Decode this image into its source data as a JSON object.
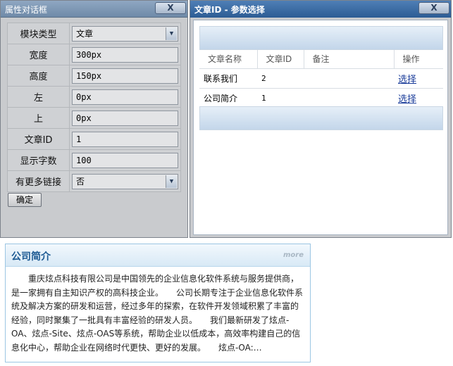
{
  "left_dialog": {
    "title": "属性对话框",
    "close_label": "X",
    "fields": [
      {
        "label": "模块类型",
        "value": "文章",
        "type": "select"
      },
      {
        "label": "宽度",
        "value": "300px",
        "type": "text"
      },
      {
        "label": "高度",
        "value": "150px",
        "type": "text"
      },
      {
        "label": "左",
        "value": "0px",
        "type": "text"
      },
      {
        "label": "上",
        "value": "0px",
        "type": "text"
      },
      {
        "label": "文章ID",
        "value": "1",
        "type": "text"
      },
      {
        "label": "显示字数",
        "value": "100",
        "type": "text"
      },
      {
        "label": "有更多链接",
        "value": "否",
        "type": "select"
      }
    ],
    "ok_label": "确定"
  },
  "right_dialog": {
    "title": "文章ID - 参数选择",
    "close_label": "X",
    "columns": [
      "文章名称",
      "文章ID",
      "备注",
      "操作"
    ],
    "rows": [
      {
        "name": "联系我们",
        "id": "2",
        "note": "",
        "action": "选择"
      },
      {
        "name": "公司简介",
        "id": "1",
        "note": "",
        "action": "选择"
      }
    ]
  },
  "panel": {
    "title": "公司简介",
    "more_label": "more",
    "body": "重庆炫点科技有限公司是中国领先的企业信息化软件系统与服务提供商，是一家拥有自主知识产权的高科技企业。　　公司长期专注于企业信息化软件系统及解决方案的研发和运营，经过多年的探索，在软件开发领域积累了丰富的经验，同时聚集了一批具有丰富经验的研发人员。　　我们最新研发了炫点-OA、炫点-Site、炫点-OAS等系统，帮助企业以低成本，高效率构建自己的信息化中心，帮助企业在网络时代更快、更好的发展。　　炫点-OA:…"
  },
  "colors": {
    "left_titlebar": "#7f98b5",
    "right_titlebar": "#3a6aa3",
    "panel_title": "#1d5a93",
    "link": "#1a3c9a"
  }
}
